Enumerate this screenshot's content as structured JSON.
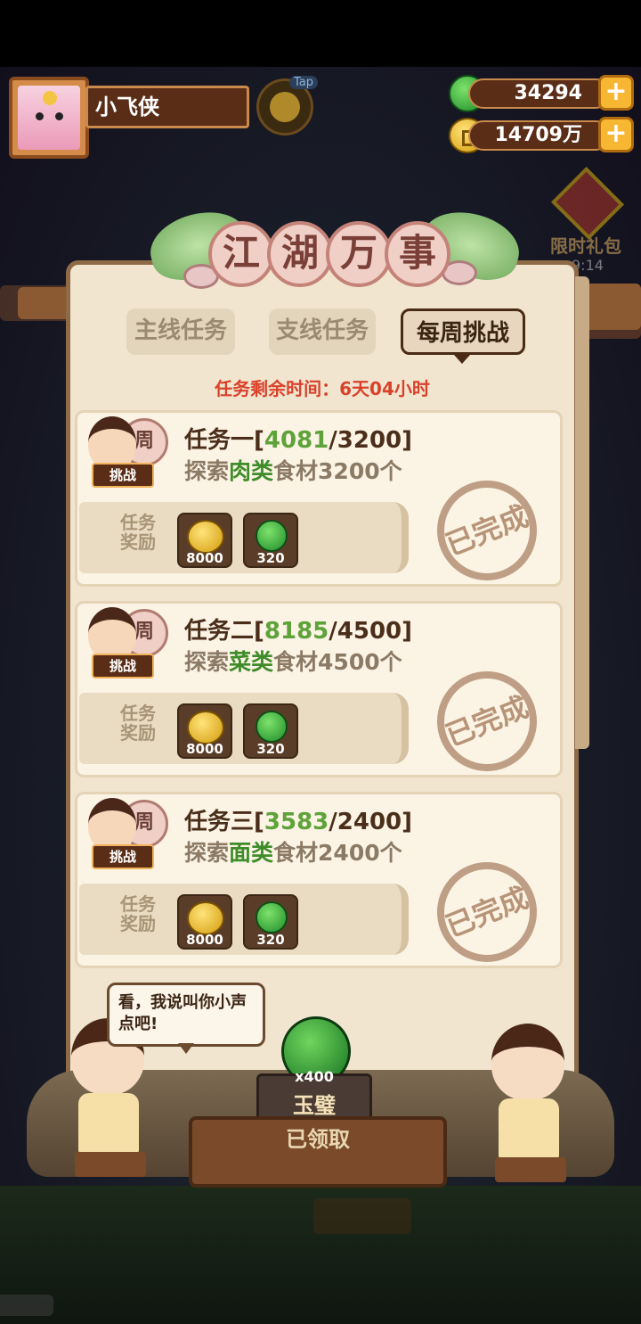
{
  "player": {
    "name": "小飞侠"
  },
  "tap_label": "Tap",
  "resources": [
    {
      "name": "jade",
      "value": "34294",
      "icon": "jade-icon"
    },
    {
      "name": "coins",
      "value": "14709万",
      "icon": "coin-icon"
    }
  ],
  "plus_label": "+",
  "event": {
    "label": "限时礼包",
    "timer": "9:14"
  },
  "panel": {
    "title_chars": [
      "江",
      "湖",
      "万",
      "事"
    ],
    "tabs": [
      {
        "label": "主线任务",
        "active": false
      },
      {
        "label": "支线任务",
        "active": false
      },
      {
        "label": "每周挑战",
        "active": true
      }
    ],
    "time_remaining": "任务剩余时间：6天04小时"
  },
  "tasks": [
    {
      "badge": "周",
      "tag": "挑战",
      "title_prefix": "任务一[",
      "progress": "4081",
      "target_sep": "/3200]",
      "desc_prefix": "探索",
      "desc_category": "肉类",
      "desc_suffix": "食材3200个",
      "reward_label": "任务奖励",
      "rewards": [
        {
          "icon": "coin-icon",
          "amount": "8000"
        },
        {
          "icon": "jade-icon",
          "amount": "320"
        }
      ],
      "status": "已完成"
    },
    {
      "badge": "周",
      "tag": "挑战",
      "title_prefix": "任务二[",
      "progress": "8185",
      "target_sep": "/4500]",
      "desc_prefix": "探索",
      "desc_category": "菜类",
      "desc_suffix": "食材4500个",
      "reward_label": "任务奖励",
      "rewards": [
        {
          "icon": "coin-icon",
          "amount": "8000"
        },
        {
          "icon": "jade-icon",
          "amount": "320"
        }
      ],
      "status": "已完成"
    },
    {
      "badge": "周",
      "tag": "挑战",
      "title_prefix": "任务三[",
      "progress": "3583",
      "target_sep": "/2400]",
      "desc_prefix": "探索",
      "desc_category": "面类",
      "desc_suffix": "食材2400个",
      "reward_label": "任务奖励",
      "rewards": [
        {
          "icon": "coin-icon",
          "amount": "8000"
        },
        {
          "icon": "jade-icon",
          "amount": "320"
        }
      ],
      "status": "已完成"
    }
  ],
  "speech": "看，我说叫你小声点吧!",
  "grand_prize": {
    "quantity": "x400",
    "name": "玉璧",
    "status": "已领取"
  },
  "colors": {
    "accent_red": "#d9412b",
    "progress_green": "#5ea23a",
    "category_green": "#3e8c2a"
  }
}
